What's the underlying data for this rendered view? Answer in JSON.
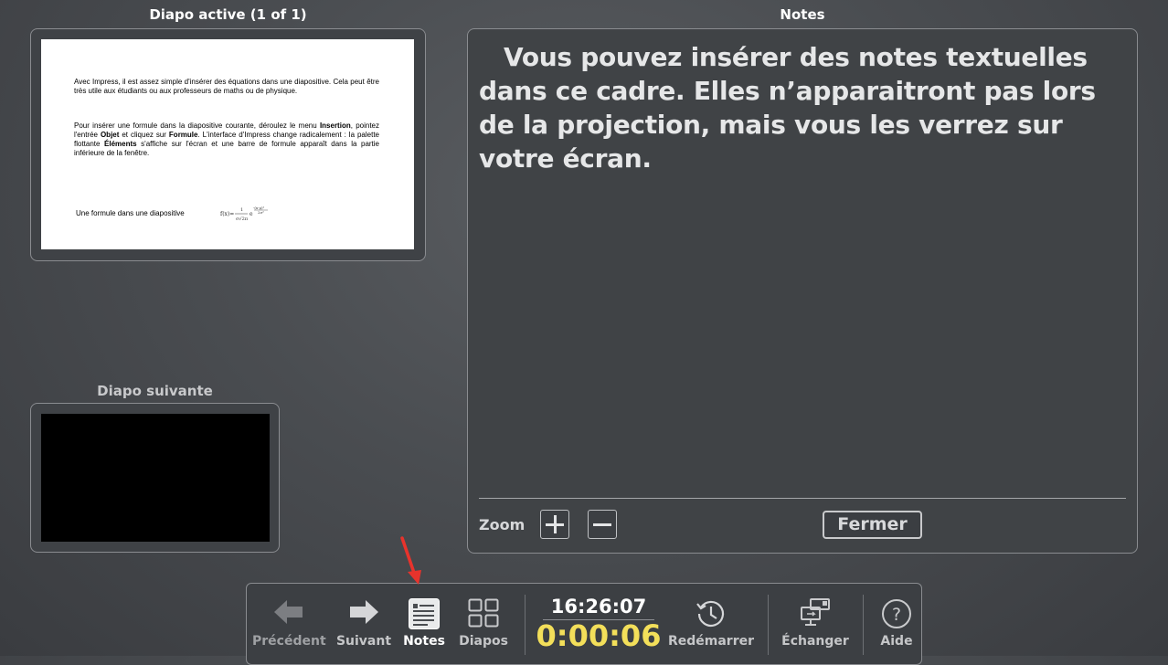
{
  "active_slide": {
    "label": "Diapo active (1 of 1)",
    "para1": "Avec Impress, il est assez simple d'insérer des équations dans une diapositive. Cela peut être très utile aux étudiants ou aux professeurs de maths ou de physique.",
    "para2_a": "Pour insérer une formule dans la diapositive courante, déroulez le menu ",
    "para2_insertion": "Insertion",
    "para2_b": ", pointez l'entrée ",
    "para2_objet": "Objet",
    "para2_c": " et cliquez sur ",
    "para2_formule": "Formule",
    "para2_d": ". L'interface d'Impress change radicalement : la palette flottante ",
    "para2_elements": "Éléments",
    "para2_e": " s'affiche sur l'écran et une barre de formule apparaît dans la partie inférieure de la fenêtre.",
    "formula_caption": "Une formule dans une diapositive"
  },
  "next_slide": {
    "label": "Diapo suivante"
  },
  "notes": {
    "label": "Notes",
    "text": "Vous pouvez insérer des notes textuelles dans ce cadre. Elles n’apparaitront pas lors de la projection, mais vous les verrez sur votre écran.",
    "zoom_label": "Zoom",
    "close_label": "Fermer"
  },
  "toolbar": {
    "prev_label": "Précédent",
    "next_label": "Suivant",
    "notes_label": "Notes",
    "slides_label": "Diapos",
    "clock": "16:26:07",
    "elapsed": "0:00:06",
    "restart_label": "Redémarrer",
    "swap_label": "Échanger",
    "help_label": "Aide"
  },
  "colors": {
    "elapsed": "#f3df5a",
    "annotation_arrow": "#e8332c"
  },
  "icons": {
    "prev": "arrow-left-icon",
    "next": "arrow-right-icon",
    "notes": "notes-icon",
    "slides": "grid-icon",
    "restart": "history-clock-icon",
    "swap": "swap-monitors-icon",
    "help": "question-icon"
  }
}
